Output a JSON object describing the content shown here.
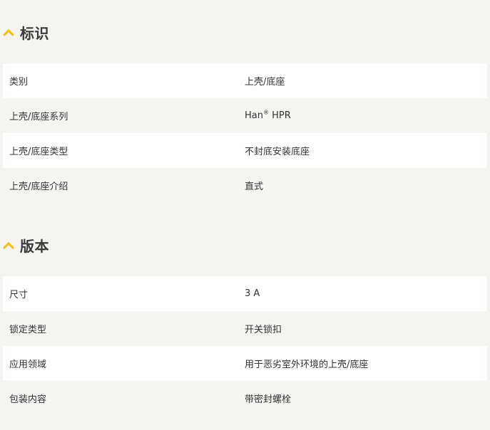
{
  "sections": [
    {
      "title": "标识",
      "rows": [
        {
          "label": "类别",
          "value": "上壳/底座"
        },
        {
          "label": "上壳/底座系列",
          "value_prefix": "Han",
          "value_sup": "®",
          "value_suffix": " HPR"
        },
        {
          "label": "上壳/底座类型",
          "value": "不封底安装底座"
        },
        {
          "label": "上壳/底座介绍",
          "value": "直式"
        }
      ]
    },
    {
      "title": "版本",
      "rows": [
        {
          "label": "尺寸",
          "value": "3 A"
        },
        {
          "label": "锁定类型",
          "value": "开关锁扣"
        },
        {
          "label": "应用领域",
          "value": "用于恶劣室外环境的上壳/底座"
        },
        {
          "label": "包装内容",
          "value": "带密封螺栓"
        }
      ]
    }
  ],
  "colors": {
    "accent": "#f2c21b",
    "row_light": "#ffffff",
    "row_dark": "#f5f4f1",
    "text": "#333333"
  },
  "icons": {
    "section_toggle": "chevron-up-icon"
  }
}
